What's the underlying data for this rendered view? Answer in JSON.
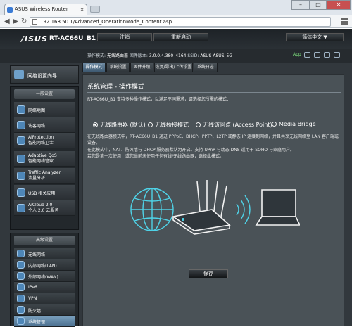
{
  "browser": {
    "tab_title": "ASUS Wireless Router",
    "url": "192.168.50.1/Advanced_OperationMode_Content.asp",
    "min": "–",
    "max": "□",
    "close": "✕"
  },
  "header": {
    "logo": "/ISUS",
    "model": "RT-AC66U_B1",
    "logout": "注销",
    "reboot": "重新启动",
    "language": "简体中文"
  },
  "status": {
    "mode_label": "操作模式:",
    "mode_value": "无线路由器",
    "fw_label": "固件版本:",
    "fw_value": "3.0.0.4.380_4164",
    "ssid_label": "SSID:",
    "ssid_1": "ASUS",
    "ssid_2": "ASUS_5G",
    "app": "App"
  },
  "sidebar": {
    "quick": "网络设置向导",
    "general": "一般设置",
    "general_items": [
      {
        "l1": "网络地图",
        "l2": ""
      },
      {
        "l1": "访客网络",
        "l2": ""
      },
      {
        "l1": "AiProtection",
        "l2": "智能网络卫士"
      },
      {
        "l1": "Adaptive QoS",
        "l2": "智能网络管家"
      },
      {
        "l1": "Traffic Analyzer",
        "l2": "流量分析"
      },
      {
        "l1": "USB 相关应用",
        "l2": ""
      },
      {
        "l1": "AiCloud 2.0",
        "l2": "个人 2.0 云服务"
      }
    ],
    "advanced": "高级设置",
    "advanced_items": [
      "无线网络",
      "内部网络(LAN)",
      "外部网络(WAN)",
      "IPv6",
      "VPN",
      "防火墙",
      "系统管理"
    ]
  },
  "tabs": [
    "操作模式",
    "系统设置",
    "固件升级",
    "恢复/导出/上传设置",
    "系统日志"
  ],
  "content": {
    "title": "系统管理 - 操作模式",
    "intro": "RT-AC66U_B1 支持多种操作模式，以满足不同需求，请选择您所需的模式：",
    "modes": [
      {
        "label": "无线路由器 (默认)",
        "selected": true
      },
      {
        "label": "无线桥接模式",
        "selected": false
      },
      {
        "label": "无线访问点 (Access Point)",
        "selected": false
      },
      {
        "label": "Media Bridge",
        "selected": false
      }
    ],
    "d1": "在无线路由器模式中，RT-AC66U_B1 通过 PPPoE、DHCP、PPTP、L2TP 或静态 IP 连接到网络，并且共享无线网络至 LAN 客户端或设备。",
    "d2": "在此模式中，NAT、防火墙与 DHCP 服务器默认为开启。支持 UPnP 与动态 DNS 适用于 SOHO 与家庭用户。",
    "d3": "若您是第一次使用，或您当前未使用任何有线/无线路由器，选择此模式。",
    "save": "保存"
  },
  "colors": {
    "accent": "#4fd3e8",
    "bg": "#32383d",
    "panel": "#4a5257"
  }
}
